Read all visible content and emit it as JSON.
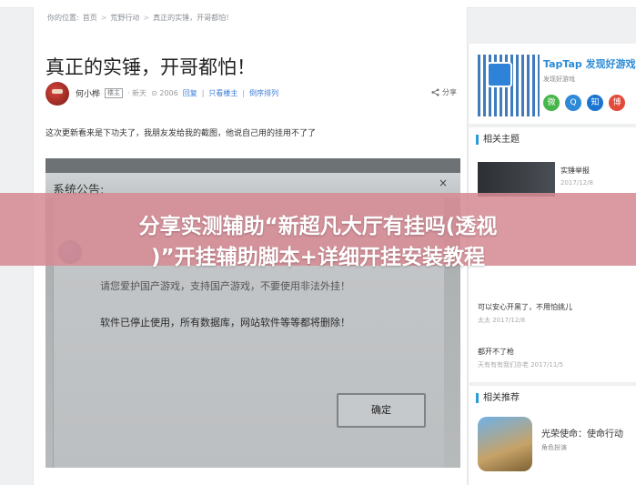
{
  "breadcrumb": {
    "location_label": "你的位置:",
    "items": [
      "首页",
      "荒野行动",
      "真正的实锤，开哥都怕！"
    ],
    "separator": ">"
  },
  "post": {
    "title": "真正的实锤，开哥都怕！",
    "author": "何小桦",
    "author_badge": "楼主",
    "time": "· 新天",
    "views": "⊙ 2006",
    "reply_link": "回复",
    "only_op_link": "只看楼主",
    "reverse_link": "倒序排列",
    "share_label": "分享",
    "body_text": "这次更新看来是下功夫了，我朋友发给我的截图，他说自己用的挂用不了了"
  },
  "screenshot_photo": {
    "notice_title": "系统公告:",
    "message_1": "请您爱护国产游戏，支持国产游戏，不要使用非法外挂！",
    "message_2": "软件已停止使用，所有数据库，网站软件等等都将删除！",
    "ok_button": "确定",
    "close_glyph": "×"
  },
  "sidebar": {
    "app": {
      "brand": "TapTap 发现好游戏",
      "tagline": "发现好游戏"
    },
    "social_icons": [
      "wechat-icon",
      "qq-icon",
      "zhihu-icon",
      "weibo-icon"
    ],
    "social_glyphs": [
      "微",
      "Q",
      "知",
      "博"
    ],
    "related_topics_title": "相关主题",
    "related_topics": [
      {
        "title": "实锤举报",
        "date": "2017/12/8"
      },
      {
        "title": "可以安心开黑了，不用怕挑儿",
        "meta": "太太  2017/12/8"
      },
      {
        "title": "都开不了枪",
        "meta": "天有有有我们亦老  2017/11/5"
      }
    ],
    "recommend_title": "相关推荐",
    "recommend": {
      "name": "光荣使命：使命行动",
      "genre": "角色扮演"
    }
  },
  "banner": {
    "line1": "分享实测辅助“新超凡大厅有挂吗(透视",
    "line2": ")”开挂辅助脚本+详细开挂安装教程"
  },
  "colors": {
    "banner_bg": "#d68b94",
    "accent": "#2c9cd6",
    "link": "#3a7bd5"
  }
}
